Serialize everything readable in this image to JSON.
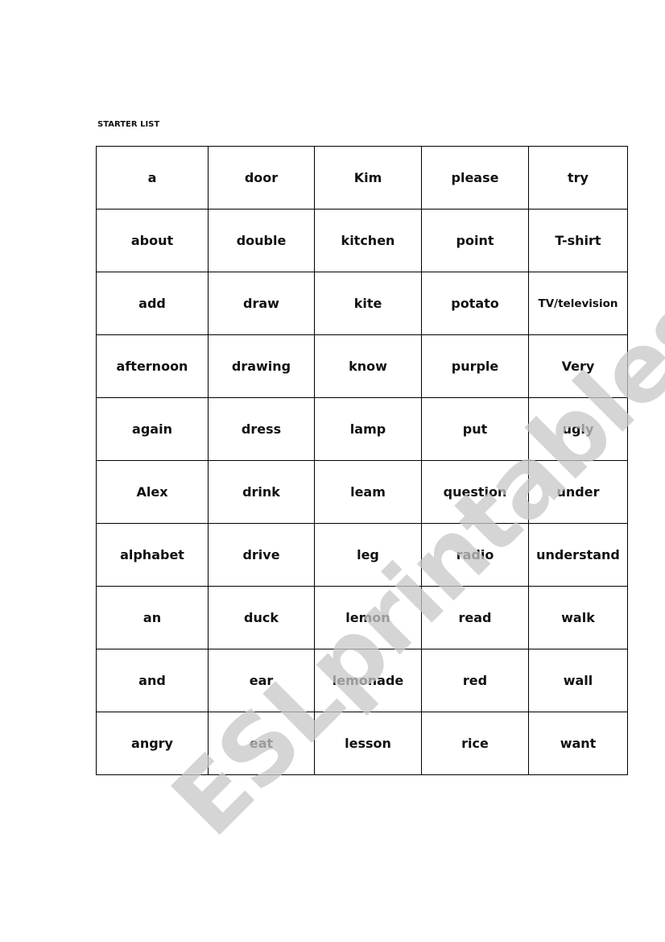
{
  "document": {
    "title": "STARTER LIST",
    "watermark": "ESLprintables.com",
    "rows": [
      [
        "a",
        "door",
        "Kim",
        "please",
        "try"
      ],
      [
        "about",
        "double",
        "kitchen",
        "point",
        "T-shirt"
      ],
      [
        "add",
        "draw",
        "kite",
        "potato",
        "TV/television"
      ],
      [
        "afternoon",
        "drawing",
        "know",
        "purple",
        "Very"
      ],
      [
        "again",
        "dress",
        "lamp",
        "put",
        "ugly"
      ],
      [
        "Alex",
        "drink",
        "leam",
        "question",
        "under"
      ],
      [
        "alphabet",
        "drive",
        "leg",
        "radio",
        "understand"
      ],
      [
        "an",
        "duck",
        "lemon",
        "read",
        "walk"
      ],
      [
        "and",
        "ear",
        "lemonade",
        "red",
        "wall"
      ],
      [
        "angry",
        "eat",
        "lesson",
        "rice",
        "want"
      ]
    ]
  }
}
